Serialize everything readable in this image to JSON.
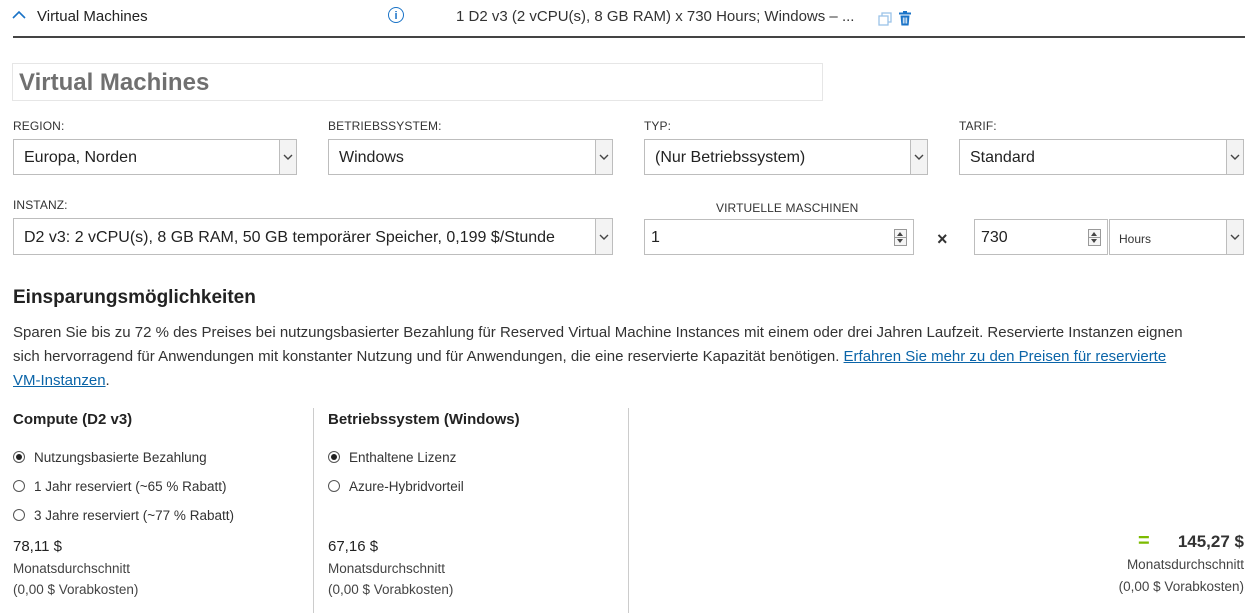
{
  "header": {
    "title": "Virtual Machines",
    "info_icon": "i",
    "summary": "1 D2 v3 (2 vCPU(s), 8 GB RAM) x 730 Hours; Windows – ..."
  },
  "card_title": "Virtual Machines",
  "fields": {
    "region": {
      "label": "REGION:",
      "value": "Europa, Norden"
    },
    "os": {
      "label": "BETRIEBSSYSTEM:",
      "value": "Windows"
    },
    "type": {
      "label": "TYP:",
      "value": "(Nur Betriebssystem)"
    },
    "tier": {
      "label": "TARIF:",
      "value": "Standard"
    },
    "instance": {
      "label": "INSTANZ:",
      "value": "D2 v3: 2 vCPU(s), 8 GB RAM, 50 GB temporärer Speicher, 0,199 $/Stunde"
    },
    "vm_count": {
      "label": "VIRTUELLE MASCHINEN",
      "value": "1"
    },
    "times": "×",
    "hours": {
      "value": "730",
      "unit": "Hours"
    }
  },
  "savings": {
    "title": "Einsparungsmöglichkeiten",
    "text_line1": "Sparen Sie bis zu 72 % des Preises bei nutzungsbasierter Bezahlung für Reserved Virtual Machine Instances mit einem oder drei Jahren Laufzeit. Reservierte Instanzen eignen",
    "text_line2": "sich hervorragend für Anwendungen mit konstanter Nutzung und für Anwendungen, die eine reservierte Kapazität benötigen.",
    "link_part1": "Erfahren Sie mehr zu den Preisen für reservierte",
    "link_part2": "VM-Instanzen",
    "link_suffix": "."
  },
  "compute": {
    "title": "Compute (D2 v3)",
    "options": [
      "Nutzungsbasierte Bezahlung",
      "1 Jahr reserviert (~65 % Rabatt)",
      "3 Jahre reserviert (~77 % Rabatt)"
    ],
    "selected": 0,
    "price": "78,11 $",
    "avg": "Monatsdurchschnitt",
    "upfront": "(0,00 $ Vorabkosten)"
  },
  "os_license": {
    "title": "Betriebssystem (Windows)",
    "options": [
      "Enthaltene Lizenz",
      "Azure-Hybridvorteil"
    ],
    "selected": 0,
    "price": "67,16 $",
    "avg": "Monatsdurchschnitt",
    "upfront": "(0,00 $ Vorabkosten)"
  },
  "total": {
    "equals": "=",
    "price": "145,27 $",
    "avg": "Monatsdurchschnitt",
    "upfront": "(0,00 $ Vorabkosten)"
  },
  "colors": {
    "accent": "#1a73c7",
    "link": "#0a64a8",
    "equals": "#7cbb00"
  }
}
